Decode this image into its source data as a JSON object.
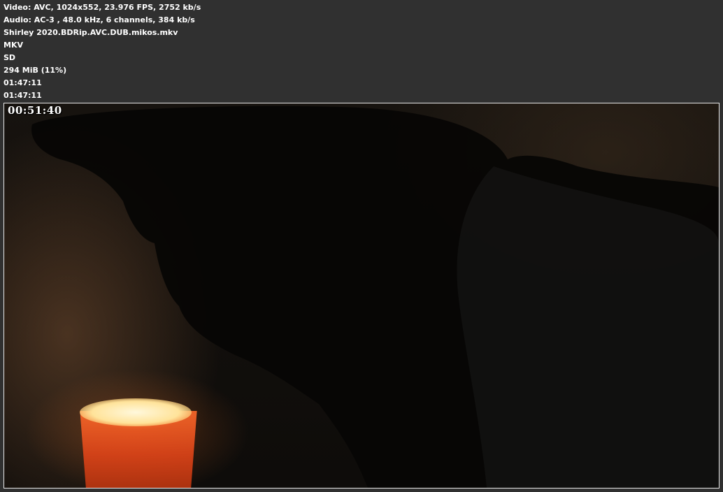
{
  "info": {
    "video": "Video: AVC, 1024x552, 23.976 FPS, 2752 kb/s",
    "audio": "Audio: AC-3 , 48.0 kHz, 6 channels, 384 kb/s",
    "filename": "Shirley 2020.BDRip.AVC.DUB.mikos.mkv",
    "container": "MKV",
    "quality": "SD",
    "size": "294 MiB (11%)",
    "duration": "01:47:11",
    "duration_repeat": "01:47:11"
  },
  "frame": {
    "timecode": "00:51:40"
  },
  "colors": {
    "background": "#303030",
    "text": "#ffffff",
    "frame_border": "#e9e9e9"
  }
}
